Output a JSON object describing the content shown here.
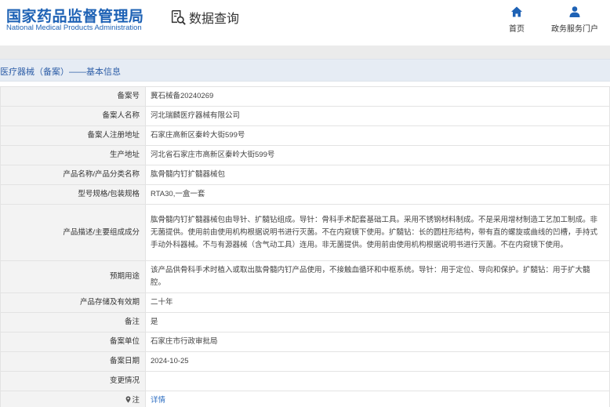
{
  "header": {
    "logo_cn": "国家药品监督管理局",
    "logo_en": "National Medical Products Administration",
    "query_label": "数据查询",
    "nav": [
      {
        "label": "首页",
        "icon": "home-icon"
      },
      {
        "label": "政务服务门户",
        "icon": "user-icon"
      }
    ]
  },
  "section_title": "医疗器械（备案）——基本信息",
  "fields": [
    {
      "label": "备案号",
      "value": "冀石械备20240269"
    },
    {
      "label": "备案人名称",
      "value": "河北瑞麟医疗器械有限公司"
    },
    {
      "label": "备案人注册地址",
      "value": "石家庄高新区秦岭大街599号"
    },
    {
      "label": "生产地址",
      "value": "河北省石家庄市高新区秦岭大街599号"
    },
    {
      "label": "产品名称/产品分类名称",
      "value": "肱骨髓内钉扩髓器械包"
    },
    {
      "label": "型号规格/包装规格",
      "value": "RTA30,一盒一套"
    },
    {
      "label": "产品描述/主要组成成分",
      "value": "肱骨髓内钉扩髓器械包由导针、扩髓钻组成。导针：骨科手术配套基础工具。采用不锈钢材料制成。不是采用增材制造工艺加工制成。非无菌提供。使用前由使用机构根据说明书进行灭菌。不在内窥镜下使用。扩髓钻：长的圆柱形结构，带有直的螺旋或曲线的凹槽，手持式手动外科器械。不与有源器械（含气动工具）连用。非无菌提供。使用前由使用机构根据说明书进行灭菌。不在内窥镜下使用。"
    },
    {
      "label": "预期用途",
      "value": "该产品供骨科手术时植入或取出肱骨髓内钉产品使用，不接触血循环和中枢系统。导针：用于定位、导向和保护。扩髓钻：用于扩大髓腔。"
    },
    {
      "label": "产品存储及有效期",
      "value": "二十年"
    },
    {
      "label": "备注",
      "value": "是"
    },
    {
      "label": "备案单位",
      "value": "石家庄市行政审批局"
    },
    {
      "label": "备案日期",
      "value": "2024-10-25"
    },
    {
      "label": "变更情况",
      "value": ""
    },
    {
      "label": "注",
      "value": "详情",
      "icon": "location-pin-icon"
    }
  ],
  "colors": {
    "brand_blue": "#1e62b5",
    "title_bg": "#e6ecf4",
    "label_bg": "#f3f3f3",
    "link": "#2f6fc2"
  }
}
